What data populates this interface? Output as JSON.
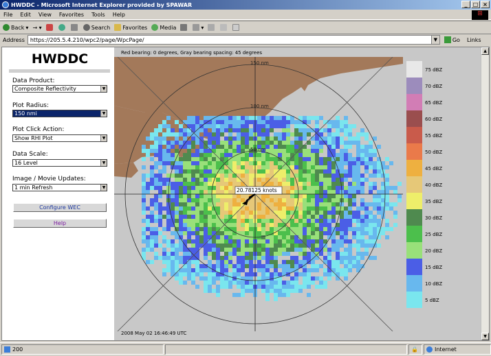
{
  "window": {
    "title": "HWDDC - Microsoft Internet Explorer provided by SPAWAR",
    "min": "_",
    "max": "□",
    "close": "×"
  },
  "menu": [
    "File",
    "Edit",
    "View",
    "Favorites",
    "Tools",
    "Help"
  ],
  "toolbar": {
    "back": "Back",
    "search": "Search",
    "favorites": "Favorites",
    "media": "Media"
  },
  "address": {
    "label": "Address",
    "value": "https://205.5.4.210/wpc2/page/WpcPage/",
    "go": "Go",
    "links": "Links"
  },
  "sidebar": {
    "logo": "HWDDC",
    "data_product_label": "Data Product:",
    "data_product_value": "Composite Reflectivity",
    "plot_radius_label": "Plot Radius:",
    "plot_radius_value": "150 nmi",
    "plot_click_label": "Plot Click Action:",
    "plot_click_value": "Show RHI Plot",
    "data_scale_label": "Data Scale:",
    "data_scale_value": "16 Level",
    "image_updates_label": "Image / Movie Updates:",
    "image_updates_value": "1 min Refresh",
    "configure_button": "Configure WEC",
    "help_button": "Help"
  },
  "radar": {
    "title": "Red bearing: 0 degrees, Gray bearing spacing: 45 degrees",
    "ring_label_150": "150 nm",
    "ring_label_100": "100 nm",
    "ring_label_50": "50 nm",
    "wind_label": "20.78125 knots",
    "timestamp": "2008 May 02   16:46:49   UTC",
    "legend": [
      {
        "label": "75 dBZ",
        "color": "#e8e8e8"
      },
      {
        "label": "70 dBZ",
        "color": "#9c8cbc"
      },
      {
        "label": "65 dBZ",
        "color": "#d27db5"
      },
      {
        "label": "60 dBZ",
        "color": "#9a4e4e"
      },
      {
        "label": "55 dBZ",
        "color": "#c95b4b"
      },
      {
        "label": "50 dBZ",
        "color": "#ea7a4a"
      },
      {
        "label": "45 dBZ",
        "color": "#eeb040"
      },
      {
        "label": "40 dBZ",
        "color": "#e6c878"
      },
      {
        "label": "35 dBZ",
        "color": "#eeee6a"
      },
      {
        "label": "30 dBZ",
        "color": "#4f8a4f"
      },
      {
        "label": "25 dBZ",
        "color": "#4cbf4c"
      },
      {
        "label": "20 dBZ",
        "color": "#99e07a"
      },
      {
        "label": "15 dBZ",
        "color": "#4b5ee6"
      },
      {
        "label": "10 dBZ",
        "color": "#68b8ee"
      },
      {
        "label": "5 dBZ",
        "color": "#7ae6ee"
      }
    ]
  },
  "status": {
    "text": "200",
    "zone": "Internet"
  }
}
